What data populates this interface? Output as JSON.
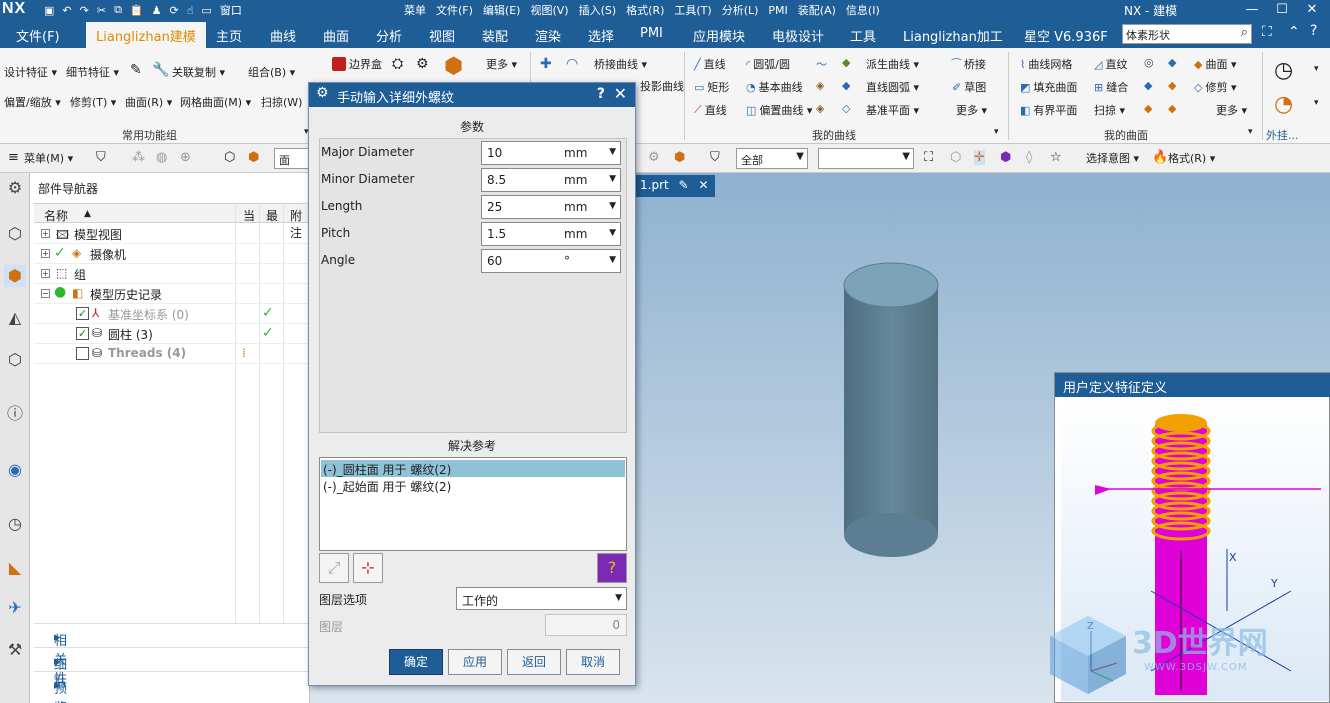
{
  "app": {
    "logo": "NX",
    "title": "NX - 建模",
    "window_menu": "窗口",
    "quick_access_icons": [
      "save-icon",
      "undo-icon",
      "redo-icon",
      "cut-icon",
      "copy-icon",
      "paste-icon",
      "user-icon",
      "repeat-icon",
      "touch-icon",
      "window-icon"
    ]
  },
  "top_menu": [
    "菜单",
    "文件(F)",
    "编辑(E)",
    "视图(V)",
    "插入(S)",
    "格式(R)",
    "工具(T)",
    "分析(L)",
    "PMI",
    "装配(A)",
    "信息(I)"
  ],
  "ribbon_tabs": {
    "items": [
      "文件(F)",
      "Lianglizhan建模",
      "主页",
      "曲线",
      "曲面",
      "分析",
      "视图",
      "装配",
      "渲染",
      "选择",
      "PMI",
      "应用模块",
      "电极设计",
      "工具",
      "Lianglizhan加工",
      "星空 V6.936F"
    ],
    "active": 1,
    "search_value": "体素形状"
  },
  "ribbon": {
    "common_rows": [
      [
        "设计特征 ▾",
        "细节特征 ▾",
        "关联复制 ▾",
        "组合(B) ▾"
      ],
      [
        "偏置/缩放 ▾",
        "修剪(T) ▾",
        "曲面(R) ▾",
        "网格曲面(M) ▾",
        "扫掠(W)"
      ]
    ],
    "common_label": "常用功能组",
    "box_label": "边界盒",
    "more1": "更多 ▾",
    "bridge_curves": [
      "桥接曲线 ▾",
      "投影曲线"
    ],
    "my_curves": {
      "col1": [
        "直线",
        "矩形",
        "直线"
      ],
      "col2": [
        "圆弧/圆",
        "基本曲线",
        "偏置曲线 ▾"
      ],
      "col3": [
        "派生曲线 ▾",
        "直线圆弧 ▾",
        "基准平面 ▾"
      ],
      "col4": [
        "桥接",
        "草图",
        "更多 ▾"
      ],
      "label": "我的曲线"
    },
    "my_surfaces": {
      "col1": [
        "曲线网格",
        "填充曲面",
        "有界平面"
      ],
      "col2": [
        "直纹",
        "缝合",
        "扫掠 ▾"
      ],
      "col3": [
        "曲面 ▾",
        "修剪 ▾",
        "更多 ▾"
      ],
      "label": "我的曲面"
    },
    "outer_label": "外挂..."
  },
  "toolbar2": {
    "menu": "菜单(M) ▾",
    "face_combo": "面",
    "filter_combo": "全部",
    "empty_combo": "",
    "select_intent": "选择意图 ▾",
    "format": "格式(R) ▾"
  },
  "navigator": {
    "title": "部件导航器",
    "columns": [
      "名称",
      "当",
      "最",
      "附注"
    ],
    "rows": [
      {
        "label": "模型视图",
        "indent": 0,
        "expander": "+"
      },
      {
        "label": "摄像机",
        "indent": 0,
        "expander": "+"
      },
      {
        "label": "组",
        "indent": 0,
        "expander": "+"
      },
      {
        "label": "模型历史记录",
        "indent": 0,
        "expander": "−"
      },
      {
        "label": "基准坐标系 (0)",
        "indent": 1,
        "checked": true,
        "latest": true
      },
      {
        "label": "圆柱 (3)",
        "indent": 1,
        "checked": true,
        "latest": true
      },
      {
        "label": "Threads (4)",
        "indent": 1,
        "checked": false,
        "latest": false
      }
    ],
    "sections": [
      "相关性",
      "细节",
      "预览"
    ]
  },
  "viewport": {
    "doc_tab": "1.prt",
    "cylinder_color": "#5d7e92"
  },
  "dialog": {
    "title": "手动输入详细外螺纹",
    "section_params": "参数",
    "params": [
      {
        "label": "Major Diameter",
        "value": "10",
        "unit": "mm"
      },
      {
        "label": "Minor Diameter",
        "value": "8.5",
        "unit": "mm"
      },
      {
        "label": "Length",
        "value": "25",
        "unit": "mm"
      },
      {
        "label": "Pitch",
        "value": "1.5",
        "unit": "mm"
      },
      {
        "label": "Angle",
        "value": "60",
        "unit": "°"
      }
    ],
    "section_refs": "解决参考",
    "refs": [
      "(-)_圆柱面 用于 螺纹(2)",
      "(-)_起始面 用于 螺纹(2)"
    ],
    "layer_label": "图层选项",
    "layer_value": "工作的",
    "layer_field_label": "图层",
    "layer_field_value": "0",
    "buttons": [
      "确定",
      "应用",
      "返回",
      "取消"
    ]
  },
  "udf_panel": {
    "title": "用户定义特征定义"
  },
  "watermark": {
    "brand": "3D世界网",
    "url": "WWW.3DSJW.COM"
  },
  "colors": {
    "accent": "#1f5d96",
    "active_tab_text": "#e08a00",
    "thread": "#e000d8",
    "thread_top": "#f0a000",
    "check_green": "#2fb82f"
  }
}
